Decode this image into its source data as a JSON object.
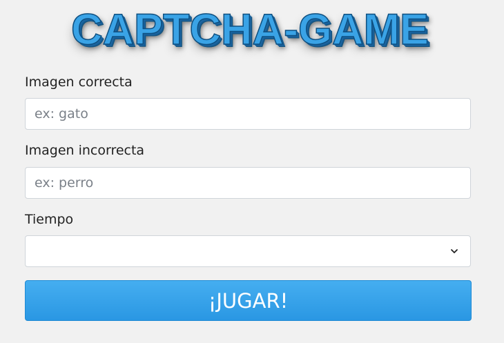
{
  "header": {
    "logo_text": "CAPTCHA-GAME"
  },
  "form": {
    "correct_label": "Imagen correcta",
    "correct_placeholder": "ex: gato",
    "correct_value": "",
    "incorrect_label": "Imagen incorrecta",
    "incorrect_placeholder": "ex: perro",
    "incorrect_value": "",
    "time_label": "Tiempo",
    "time_value": "",
    "play_label": "¡JUGAR!"
  },
  "icons": {
    "select_arrow": "chevron-down-icon"
  },
  "colors": {
    "background": "#f1f1f1",
    "button": "#2a97e3",
    "logo": "#3aa3e6"
  }
}
